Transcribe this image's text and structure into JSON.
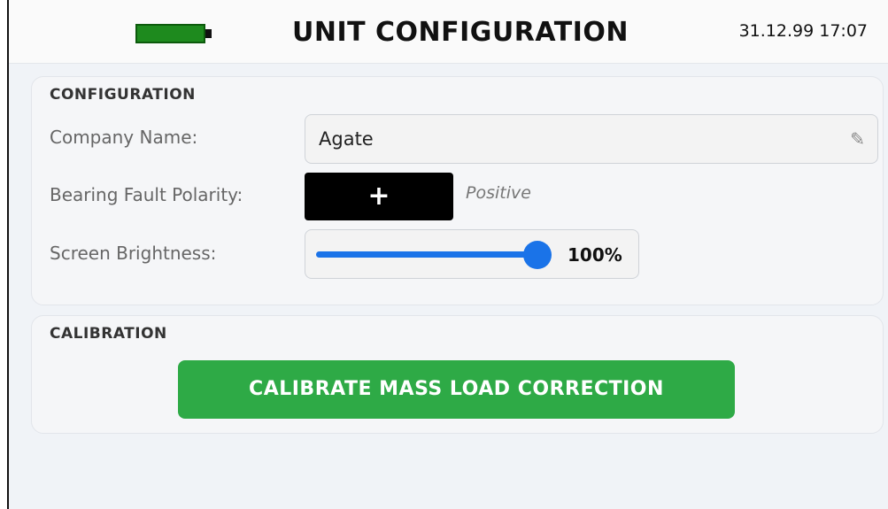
{
  "header": {
    "title": "UNIT CONFIGURATION",
    "datetime": "31.12.99 17:07",
    "battery_icon": "battery-full-icon",
    "battery_color": "#1e8a1e"
  },
  "configuration": {
    "section_title": "CONFIGURATION",
    "company_name": {
      "label": "Company Name:",
      "value": "Agate",
      "edit_icon": "pencil-icon"
    },
    "bearing_fault_polarity": {
      "label": "Bearing Fault Polarity:",
      "button_symbol": "+",
      "state_text": "Positive"
    },
    "screen_brightness": {
      "label": "Screen Brightness:",
      "level": 1.0,
      "value_text": "100%",
      "accent_color": "#1a73e8"
    }
  },
  "calibration": {
    "section_title": "CALIBRATION",
    "button_label": "CALIBRATE MASS LOAD CORRECTION",
    "button_color": "#2eaa46"
  }
}
